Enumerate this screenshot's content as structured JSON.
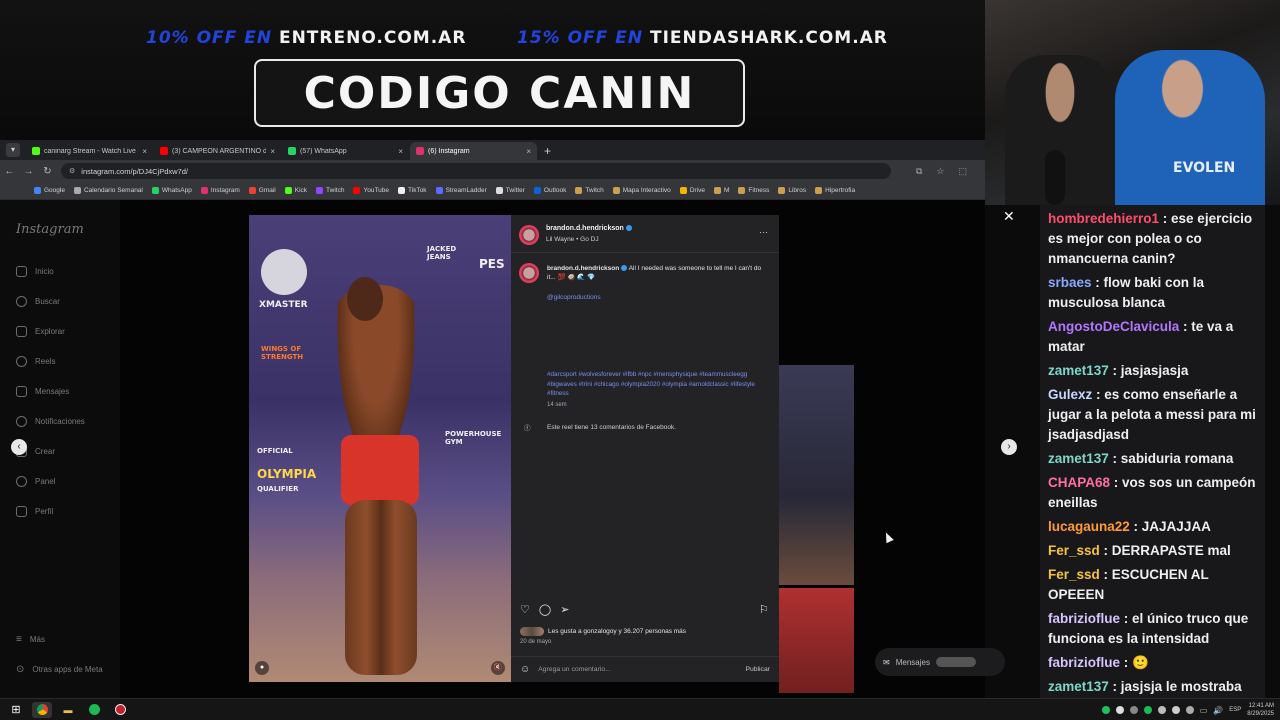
{
  "overlay": {
    "promo1_off": "10% OFF EN",
    "promo1_site": "ENTRENO.COM.AR",
    "promo2_off": "15% OFF EN",
    "promo2_site": "TIENDASHARK.COM.AR",
    "code": "CODIGO CANIN"
  },
  "webcam": {
    "shirt_text": "EVOLEN"
  },
  "browser": {
    "tabs": [
      {
        "title": "caninarg Stream - Watch Live o",
        "color": "#53fc18",
        "icon": "kick-icon"
      },
      {
        "title": "(3) CAMPEÓN ARGENTINO de",
        "color": "#ff0000",
        "icon": "youtube-icon"
      },
      {
        "title": "(57) WhatsApp",
        "color": "#25d366",
        "icon": "whatsapp-icon"
      },
      {
        "title": "(6) Instagram",
        "color": "#e1306c",
        "icon": "instagram-icon"
      }
    ],
    "url": "instagram.com/p/DJ4CjPdxw7d/",
    "bookmarks": [
      {
        "label": "Google",
        "color": "#4285f4"
      },
      {
        "label": "Calendario Semanal",
        "color": "#aaaaaa"
      },
      {
        "label": "WhatsApp",
        "color": "#25d366"
      },
      {
        "label": "Instagram",
        "color": "#e1306c"
      },
      {
        "label": "Gmail",
        "color": "#ea4335"
      },
      {
        "label": "Kick",
        "color": "#53fc18"
      },
      {
        "label": "Twitch",
        "color": "#9146ff"
      },
      {
        "label": "YouTube",
        "color": "#ff0000"
      },
      {
        "label": "TikTok",
        "color": "#eeeeee"
      },
      {
        "label": "StreamLadder",
        "color": "#5b6cff"
      },
      {
        "label": "Twitter",
        "color": "#dddddd"
      },
      {
        "label": "Outlook",
        "color": "#0a64d8"
      },
      {
        "label": "Twitch",
        "color": "#c8a050"
      },
      {
        "label": "Mapa Interactivo",
        "color": "#c8a050"
      },
      {
        "label": "Drive",
        "color": "#f4b400"
      },
      {
        "label": "M",
        "color": "#c8a050"
      },
      {
        "label": "Fitness",
        "color": "#c8a050"
      },
      {
        "label": "Libros",
        "color": "#c8a050"
      },
      {
        "label": "Hipertrofia",
        "color": "#c8a050"
      }
    ]
  },
  "instagram": {
    "logo": "Instagram",
    "nav": [
      {
        "label": "Inicio",
        "icon": "home-icon"
      },
      {
        "label": "Buscar",
        "icon": "search-icon"
      },
      {
        "label": "Explorar",
        "icon": "compass-icon"
      },
      {
        "label": "Reels",
        "icon": "reels-icon"
      },
      {
        "label": "Mensajes",
        "icon": "messenger-icon"
      },
      {
        "label": "Notificaciones",
        "icon": "heart-icon"
      },
      {
        "label": "Crear",
        "icon": "plus-icon"
      },
      {
        "label": "Panel",
        "icon": "dashboard-icon"
      },
      {
        "label": "Perfil",
        "icon": "profile-icon"
      }
    ],
    "more": "Más",
    "meta_apps": "Otras apps de Meta",
    "post": {
      "username": "brandon.d.hendrickson",
      "audio": "Lil Wayne • Go DJ",
      "caption": "All I needed was someone to tell me I can't do it... 💯 🥥 🌊 💎",
      "mention": "@gilcoproductions",
      "hashtags": "#darcsport #wolvesforever #ifbb #npc #mensphysique #teammuscleegg #bigwaves #trini #chicago #olympia2020 #olympia #arnoldclassic #lifestyle #fitness",
      "time": "14 sem",
      "fb_comments": "Este reel tiene 13 comentarios de Facebook.",
      "likes": "Les gusta a gonzalogoy y 36.207 personas más",
      "date": "20 de mayo",
      "comment_placeholder": "Agrega un comentario...",
      "publish": "Publicar"
    },
    "photo_texts": {
      "brand1": "XMASTER",
      "brand2": "JACKED JEANS",
      "brand3": "PES",
      "wings": "WINGS OF STRENGTH",
      "olympia": "OLYMPIA",
      "official": "OFFICIAL",
      "qualifier": "QUALIFIER",
      "powerhouse": "POWERHOUSE GYM"
    },
    "messages_pill": "Mensajes"
  },
  "chat": [
    {
      "user": "hombredehierro1",
      "color": "#ff4d6d",
      "text": "ese ejercicio es mejor con polea o co nmancuerna canin?"
    },
    {
      "user": "srbaes",
      "color": "#8aa8ff",
      "text": "flow baki con la musculosa blanca"
    },
    {
      "user": "AngostoDeClavicula",
      "color": "#b277ff",
      "text": "te va a matar"
    },
    {
      "user": "zamet137",
      "color": "#7fd6c8",
      "text": "jasjasjasja"
    },
    {
      "user": "Gulexz",
      "color": "#c8d8ff",
      "text": "es como enseñarle a jugar a la pelota a messi para mi jsadjasdjasd"
    },
    {
      "user": "zamet137",
      "color": "#7fd6c8",
      "text": "sabiduria romana"
    },
    {
      "user": "CHAPA68",
      "color": "#ff6fa0",
      "text": "vos sos un campeón eneillas"
    },
    {
      "user": "lucagauna22",
      "color": "#ff9a3c",
      "text": "JAJAJJAA"
    },
    {
      "user": "Fer_ssd",
      "color": "#f5c242",
      "text": "DERRAPASTE mal"
    },
    {
      "user": "Fer_ssd",
      "color": "#f5c242",
      "text": "ESCUCHEN AL OPEEEN"
    },
    {
      "user": "fabrizioflue",
      "color": "#d7c4ff",
      "text": "el único truco que funciona es la intensidad"
    },
    {
      "user": "fabrizioflue",
      "color": "#d7c4ff",
      "text": "🙂"
    },
    {
      "user": "zamet137",
      "color": "#7fd6c8",
      "text": "jasjsja le mostraba su ig"
    }
  ],
  "taskbar": {
    "lang": "ESP",
    "time": "12:41 AM",
    "date": "8/29/2025"
  }
}
